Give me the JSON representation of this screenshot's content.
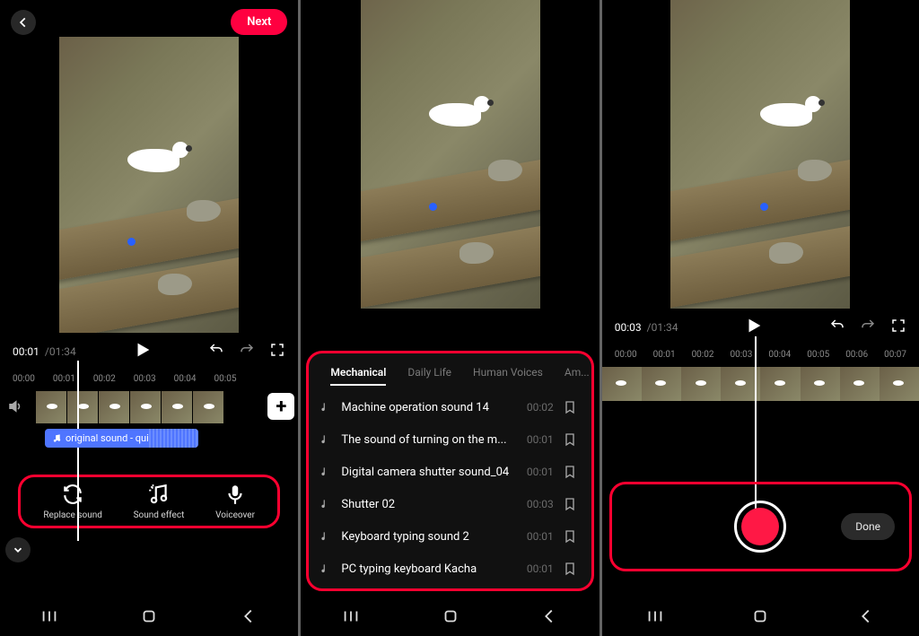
{
  "panel1": {
    "next_label": "Next",
    "time_elapsed": "00:01",
    "time_total": "/01:34",
    "ruler": [
      "00:00",
      "00:01",
      "00:02",
      "00:03",
      "00:04",
      "00:05"
    ],
    "sound_chip": "original sound - quizlightning",
    "tools": {
      "replace": "Replace sound",
      "effect": "Sound effect",
      "voiceover": "Voiceover"
    }
  },
  "panel2": {
    "tabs": [
      "Mechanical",
      "Daily Life",
      "Human Voices",
      "Am..."
    ],
    "sfx": [
      {
        "title": "Machine operation sound 14",
        "dur": "00:02"
      },
      {
        "title": "The sound of turning on the m...",
        "dur": "00:01"
      },
      {
        "title": "Digital camera shutter sound_04",
        "dur": "00:01"
      },
      {
        "title": "Shutter 02",
        "dur": "00:03"
      },
      {
        "title": "Keyboard typing sound 2",
        "dur": "00:01"
      },
      {
        "title": "PC typing keyboard Kacha",
        "dur": "00:01"
      }
    ]
  },
  "panel3": {
    "time_elapsed": "00:03",
    "time_total": "/01:34",
    "ruler": [
      "00:00",
      "00:01",
      "00:02",
      "00:03",
      "00:04",
      "00:05",
      "00:06",
      "00:07"
    ],
    "done_label": "Done"
  }
}
